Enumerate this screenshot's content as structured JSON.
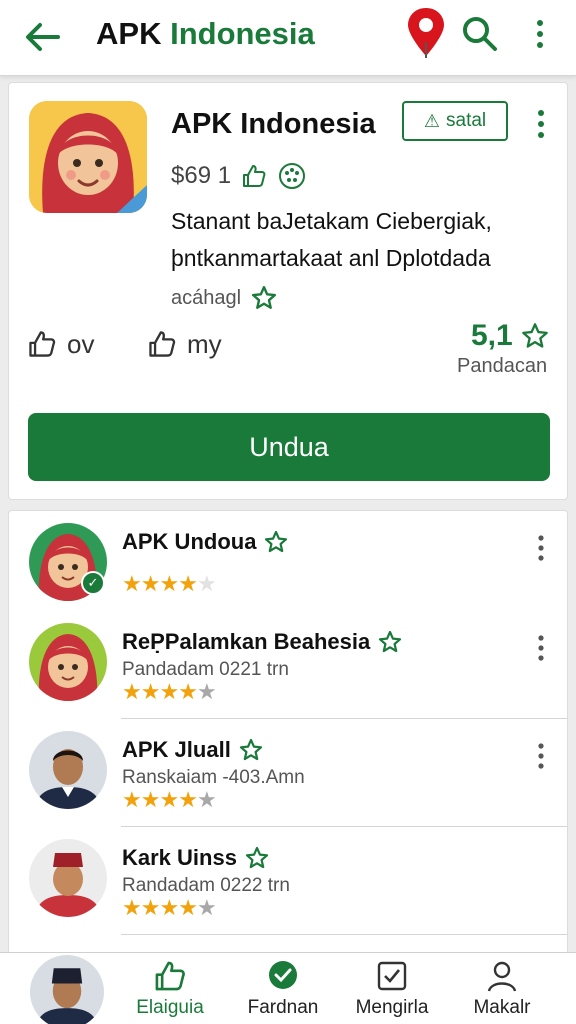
{
  "header": {
    "title_part1": "APK",
    "title_part2": "Indonesia",
    "colors": {
      "brand_green": "#1a7a3a",
      "pin_red": "#d8141c"
    }
  },
  "app": {
    "name": "APK Indonesia",
    "install_chip_label": "satal",
    "meta_count": "$69 1",
    "description_line1": "Stanant baJetakam Ciebergiak,",
    "description_line2": "þntkanmartakaat anl Dplotdada",
    "category": "acáhagl",
    "stat1_label": "ov",
    "stat2_label": "my",
    "rating_value": "5,1",
    "rating_label": "Pandacan",
    "download_label": "Undua"
  },
  "reviews": [
    {
      "name": "APK Undoua",
      "subtitle": "",
      "rating": 3.5,
      "verified": true
    },
    {
      "name": "ReP̣Palamkan Beahesia",
      "subtitle": "Pandadam 0221 trn",
      "rating": 4,
      "verified": false
    },
    {
      "name": "APK Jluall",
      "subtitle": "Ranskaiam -403.Amn",
      "rating": 4,
      "verified": false
    },
    {
      "name": "Kark Uinss",
      "subtitle": "Randadam 0222 trn",
      "rating": 4,
      "verified": false
    }
  ],
  "bottom_nav": {
    "items": [
      {
        "label": "Elaiguia",
        "icon": "thumbs-up-icon",
        "active": true
      },
      {
        "label": "Fardnan",
        "icon": "chat-check-icon",
        "active": false
      },
      {
        "label": "Mengirla",
        "icon": "checkbox-icon",
        "active": false
      },
      {
        "label": "Makalr",
        "icon": "person-icon",
        "active": false
      }
    ]
  }
}
